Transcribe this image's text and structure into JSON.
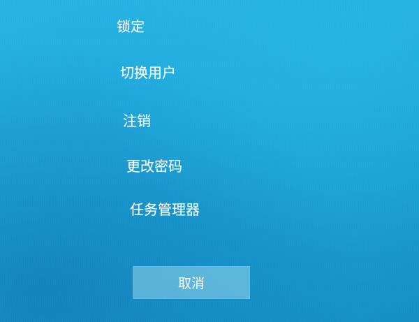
{
  "security_options": {
    "lock_label": "锁定",
    "switch_user_label": "切换用户",
    "sign_out_label": "注销",
    "change_password_label": "更改密码",
    "task_manager_label": "任务管理器"
  },
  "cancel_button": {
    "label": "取消"
  },
  "colors": {
    "background": "#1da9dd",
    "text": "#ffffff",
    "button": "#7fcbe6"
  }
}
